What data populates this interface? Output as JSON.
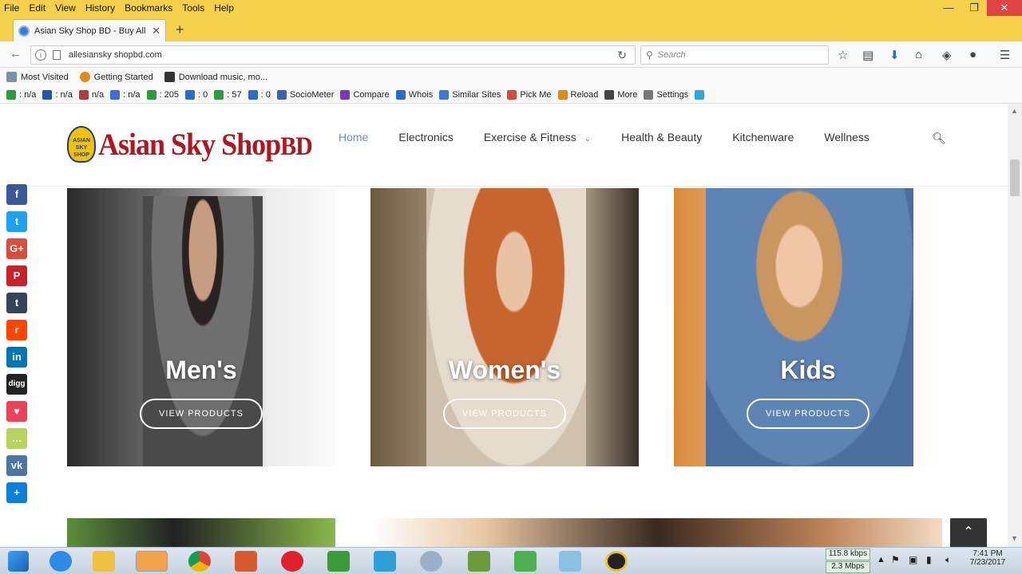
{
  "menubar": {
    "items": [
      "File",
      "Edit",
      "View",
      "History",
      "Bookmarks",
      "Tools",
      "Help"
    ]
  },
  "window_controls": {
    "minimize": "—",
    "maximize": "❐",
    "close": "✕"
  },
  "tab": {
    "title": "Asian Sky Shop BD - Buy All",
    "close": "✕",
    "new_tab": "+"
  },
  "navbar": {
    "url": "allesiansky shopbd.com",
    "search_placeholder": "Search"
  },
  "bookmarks": [
    "Most Visited",
    "Getting Started",
    "Download music, mo..."
  ],
  "addons": [
    {
      "label": ": n/a",
      "color": "#2a9d3a"
    },
    {
      "label": ": n/a",
      "color": "#2554a8"
    },
    {
      "label": "n/a",
      "color": "#b13a3a"
    },
    {
      "label": ": n/a",
      "color": "#3a6fd8"
    },
    {
      "label": ": 205",
      "color": "#2a9d3a"
    },
    {
      "label": ": 0",
      "color": "#2b6bd1"
    },
    {
      "label": ": 57",
      "color": "#2a9d3a"
    },
    {
      "label": ": 0",
      "color": "#2b6bd1"
    },
    {
      "label": "SocioMeter",
      "color": "#3a63b8"
    },
    {
      "label": "Compare",
      "color": "#7a3ab8"
    },
    {
      "label": "Whois",
      "color": "#2b6bd1"
    },
    {
      "label": "Similar Sites",
      "color": "#3a7bd5"
    },
    {
      "label": "Pick Me",
      "color": "#d84a3a"
    },
    {
      "label": "Reload",
      "color": "#e08a1a"
    },
    {
      "label": "More",
      "color": "#444444"
    },
    {
      "label": "Settings",
      "color": "#777777"
    },
    {
      "label": "",
      "color": "#2ba7e0"
    }
  ],
  "site": {
    "logo_main": "Asian Sky Shop",
    "logo_suffix": "BD",
    "logo_seal": "ASIAN SKY SHOP",
    "nav": [
      "Home",
      "Electronics",
      "Exercise & Fitness",
      "Health & Beauty",
      "Kitchenware",
      "Wellness"
    ],
    "cards": [
      {
        "title": "Men's",
        "button": "VIEW PRODUCTS"
      },
      {
        "title": "Women's",
        "button": "VIEW PRODUCTS"
      },
      {
        "title": "Kids",
        "button": "VIEW PRODUCTS"
      }
    ]
  },
  "share_icons": [
    {
      "name": "facebook-icon",
      "glyph": "f",
      "color": "#3b5998"
    },
    {
      "name": "twitter-icon",
      "glyph": "t",
      "color": "#1da1f2"
    },
    {
      "name": "googleplus-icon",
      "glyph": "G+",
      "color": "#dd4b39"
    },
    {
      "name": "pinterest-icon",
      "glyph": "P",
      "color": "#cb2027"
    },
    {
      "name": "tumblr-icon",
      "glyph": "t",
      "color": "#35465c"
    },
    {
      "name": "reddit-icon",
      "glyph": "r",
      "color": "#ff4500"
    },
    {
      "name": "linkedin-icon",
      "glyph": "in",
      "color": "#0077b5"
    },
    {
      "name": "digg-icon",
      "glyph": "digg",
      "color": "#222222"
    },
    {
      "name": "pocket-icon",
      "glyph": "♥",
      "color": "#ef4056"
    },
    {
      "name": "chat-icon",
      "glyph": "…",
      "color": "#b6d35e"
    },
    {
      "name": "vk-icon",
      "glyph": "vk",
      "color": "#4c75a3"
    },
    {
      "name": "share-plus-icon",
      "glyph": "+",
      "color": "#0b7fe0"
    }
  ],
  "tray": {
    "speed_up": "115.8 kbps",
    "speed_down": "2.3 Mbps",
    "time": "7:41 PM",
    "date": "7/23/2017"
  }
}
